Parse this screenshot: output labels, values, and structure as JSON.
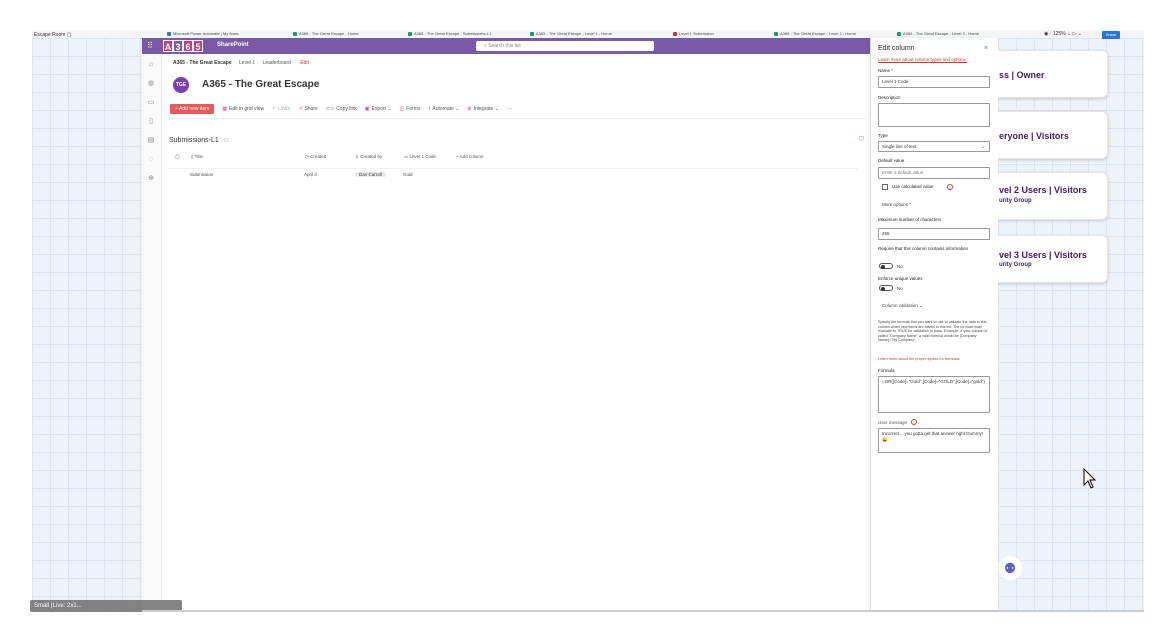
{
  "app": {
    "board_name": "Escape Room",
    "zoom": "125%",
    "share_label": "Share",
    "tabs": [
      {
        "label": "Microsoft Power Automate | My flows",
        "color": "#2b74d8"
      },
      {
        "label": "A365 - The Great Escape - Home",
        "color": "#1a9c6a"
      },
      {
        "label": "A365 - The Great Escape - Submissions-L1",
        "color": "#1a9c6a"
      },
      {
        "label": "A365 - The Great Escape - Level 1 - Home",
        "color": "#1a9c6a"
      },
      {
        "label": "Level 1 Submission",
        "color": "#c43a3a"
      },
      {
        "label": "A365 - The Great Escape - Level 2 - Home",
        "color": "#1a9c6a"
      },
      {
        "label": "A365 - The Great Escape - Level 3 - Home",
        "color": "#1a9c6a"
      }
    ]
  },
  "suite": {
    "logo_letters": [
      "A",
      "3",
      "6",
      "5"
    ],
    "logo_colors": [
      "#c0417f",
      "#7a5aa6",
      "#c0417f",
      "#c0417f"
    ],
    "app_name": "SharePoint",
    "search_placeholder": "Search this list"
  },
  "site": {
    "breadcrumb_site": "A365 - The Great Escape",
    "breadcrumb_level": "Level 1",
    "breadcrumb_leaderboard": "Leaderboard",
    "breadcrumb_edit": "Edit",
    "logo_text": "TGE",
    "title": "A365 - The Great Escape"
  },
  "commands": {
    "new_item": "+ Add new item",
    "edit_grid": "Edit in grid view",
    "undo": "Undo",
    "share": "Share",
    "copy_link": "Copy link",
    "export": "Export",
    "forms": "Forms",
    "automate": "Automate",
    "integrate": "Integrate",
    "more": "···"
  },
  "list": {
    "title": "Submissions-L1",
    "columns": [
      "Title",
      "Created",
      "Created by",
      "Level 1 Code",
      "+ Add column"
    ],
    "rows": [
      {
        "title": "Submission",
        "created": "April 3",
        "created_by": "Dan Carroll",
        "code": "Gold"
      }
    ]
  },
  "panel": {
    "title": "Edit column",
    "close": "×",
    "learn_types": "Learn more about column types and options.",
    "name_label": "Name *",
    "name_value": "Level 1 Code",
    "description_label": "Description",
    "type_label": "Type",
    "type_value": "Single line of text",
    "default_label": "Default value",
    "default_placeholder": "Enter a default value",
    "use_calc": "Use calculated value",
    "more_options": "More options ^",
    "max_chars_label": "Maximum number of characters",
    "max_chars_value": "255",
    "require_label": "Require that this column contains information",
    "require_value": "No",
    "unique_label": "Enforce unique values",
    "unique_value": "No",
    "validation_label": "Column validation ⌄",
    "validation_desc": "Specify the formula that you want to use to validate the data in this column when new items are saved to this list. The formula must evaluate to TRUE for validation to pass. Example: If your column is called \"Company Name\" a valid formula would be [Company Name]=\"My Company\".",
    "learn_formulas": "Learn more about the proper syntax for formulas.",
    "formula_label": "Formula",
    "formula_value": "=OR([Code]=\"Gold\",[Code]=\"GOLD\",[Code]=\"gold\")",
    "user_msg_label": "User message",
    "user_msg_value": "Incorrect... you gotta get that answer right Dummy! 😜"
  },
  "cards": [
    {
      "text": "ss | Owner",
      "sub": ""
    },
    {
      "text": "eryone | Visitors",
      "sub": ""
    },
    {
      "text": "vel 2 Users | Visitors",
      "sub": "urity Group"
    },
    {
      "text": "vel 3 Users | Visitors",
      "sub": "urity Group"
    }
  ],
  "bottom_pill_text": "Small (Live: 2x1..."
}
